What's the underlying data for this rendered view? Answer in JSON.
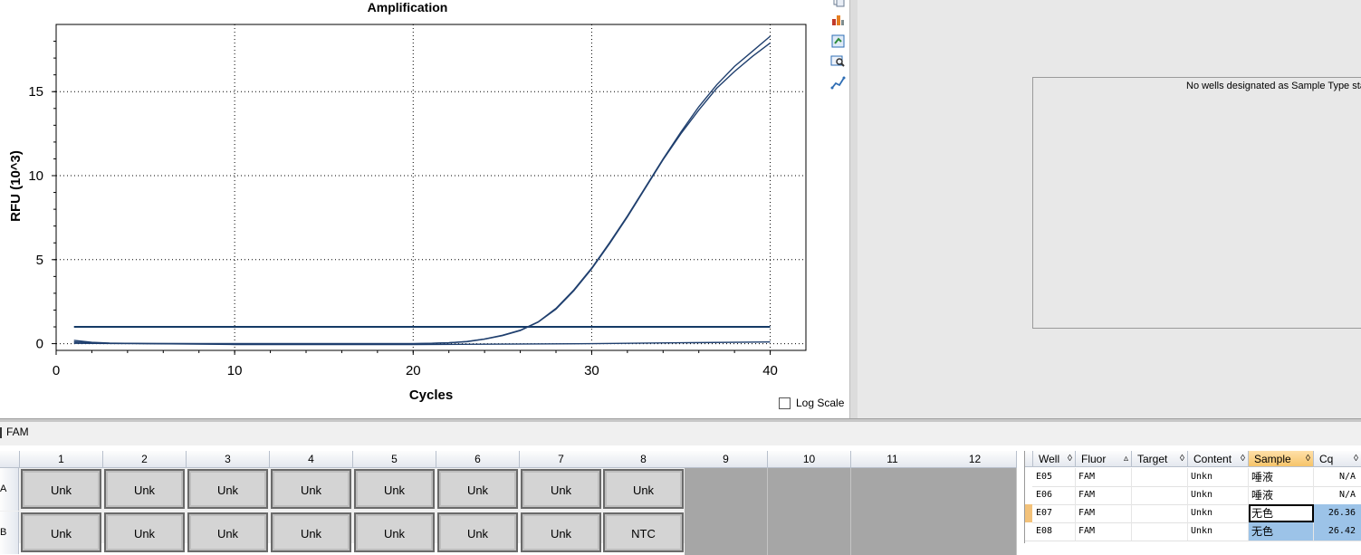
{
  "chart_data": {
    "type": "line",
    "title": "Amplification",
    "xlabel": "Cycles",
    "ylabel": "RFU (10^3)",
    "xlim": [
      0,
      42
    ],
    "ylim": [
      -0.4,
      19
    ],
    "xticks": [
      "0",
      "10",
      "20",
      "30",
      "40"
    ],
    "yticks": [
      "0",
      "5",
      "10",
      "15"
    ],
    "grid": true,
    "threshold": 1.0,
    "series": [
      {
        "x": [
          1,
          2,
          3,
          5,
          8,
          12,
          16,
          20,
          21,
          22,
          23,
          24,
          25,
          26,
          27,
          28,
          29,
          30,
          31,
          32,
          33,
          34,
          35,
          36,
          37,
          38,
          39,
          40
        ],
        "y": [
          0.2,
          0.08,
          0.03,
          0.01,
          0,
          0,
          0,
          0,
          0.02,
          0.05,
          0.13,
          0.28,
          0.5,
          0.8,
          1.3,
          2.1,
          3.2,
          4.5,
          6.0,
          7.6,
          9.3,
          11.0,
          12.6,
          14.1,
          15.4,
          16.5,
          17.4,
          18.3
        ],
        "color": "#1f3f6e"
      },
      {
        "x": [
          1,
          2,
          3,
          5,
          8,
          12,
          16,
          20,
          21,
          22,
          23,
          24,
          25,
          26,
          27,
          28,
          29,
          30,
          31,
          32,
          33,
          34,
          35,
          36,
          37,
          38,
          39,
          40
        ],
        "y": [
          0.1,
          0.05,
          0.02,
          0.01,
          0,
          0,
          0,
          0,
          0.02,
          0.05,
          0.12,
          0.27,
          0.48,
          0.78,
          1.28,
          2.05,
          3.15,
          4.45,
          5.95,
          7.55,
          9.25,
          10.95,
          12.5,
          13.9,
          15.2,
          16.2,
          17.1,
          17.9
        ],
        "color": "#1f3f6e"
      },
      {
        "x": [
          1,
          5,
          10,
          15,
          20,
          25,
          30,
          35,
          40
        ],
        "y": [
          0.02,
          0,
          -0.05,
          -0.05,
          -0.05,
          -0.03,
          0,
          0.05,
          0.1
        ],
        "color": "#1f3f6e"
      }
    ]
  },
  "log_scale_label": "Log Scale",
  "no_std_message": "No wells designated as Sample Type sta",
  "fluor_tab": "FAM",
  "plate": {
    "columns": [
      "1",
      "2",
      "3",
      "4",
      "5",
      "6",
      "7",
      "8",
      "9",
      "10",
      "11",
      "12"
    ],
    "rows": [
      {
        "label": "A",
        "wells": [
          "Unk",
          "Unk",
          "Unk",
          "Unk",
          "Unk",
          "Unk",
          "Unk",
          "Unk"
        ]
      },
      {
        "label": "B",
        "wells": [
          "Unk",
          "Unk",
          "Unk",
          "Unk",
          "Unk",
          "Unk",
          "Unk",
          "NTC"
        ]
      }
    ]
  },
  "grid": {
    "headers": [
      "Well",
      "Fluor",
      "Target",
      "Content",
      "Sample",
      "Cq"
    ],
    "rows": [
      {
        "well": "E05",
        "fluor": "FAM",
        "target": "",
        "content": "Unkn",
        "sample": "唾液",
        "cq": "N/A"
      },
      {
        "well": "E06",
        "fluor": "FAM",
        "target": "",
        "content": "Unkn",
        "sample": "唾液",
        "cq": "N/A"
      },
      {
        "well": "E07",
        "fluor": "FAM",
        "target": "",
        "content": "Unkn",
        "sample": "无色",
        "cq": "26.36"
      },
      {
        "well": "E08",
        "fluor": "FAM",
        "target": "",
        "content": "Unkn",
        "sample": "无色",
        "cq": "26.42"
      }
    ]
  },
  "colors": {
    "curve": "#1f3f6e",
    "selected": "#9cc3e8",
    "header_active": "#f6c46a"
  }
}
